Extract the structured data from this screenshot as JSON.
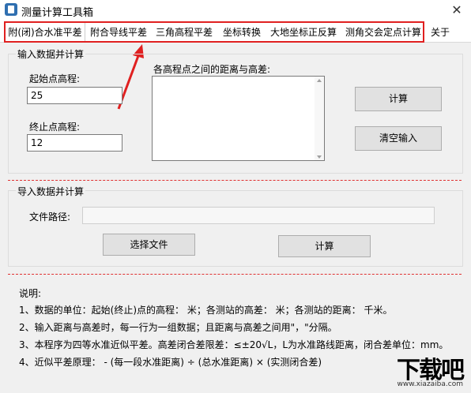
{
  "window": {
    "title": "测量计算工具箱",
    "close_glyph": "✕"
  },
  "tabs": [
    {
      "label": "附(闭)合水准平差"
    },
    {
      "label": "附合导线平差"
    },
    {
      "label": "三角高程平差"
    },
    {
      "label": "坐标转换"
    },
    {
      "label": "大地坐标正反算"
    },
    {
      "label": "测角交会定点计算"
    },
    {
      "label": "关于"
    }
  ],
  "input_group": {
    "title": "输入数据并计算",
    "start_label": "起始点高程:",
    "start_value": "25",
    "end_label": "终止点高程:",
    "end_value": "12",
    "distance_label": "各高程点之间的距离与高差:",
    "calc_button": "计算",
    "clear_button": "清空输入"
  },
  "import_group": {
    "title": "导入数据并计算",
    "path_label": "文件路径:",
    "path_value": "",
    "choose_button": "选择文件",
    "calc_button": "计算"
  },
  "notes": {
    "title": "说明:",
    "lines": [
      "1、数据的单位：起始(终止)点的高程：  米；各测站的高差：  米；各测站的距离：  千米。",
      "2、输入距离与高差时，每一行为一组数据；且距离与高差之间用\"，\"分隔。",
      "3、本程序为四等水准近似平差。高差闭合差限差：≤±20√L，L为水准路线距离，闭合差单位：mm。",
      "4、近似平差原理：  - (每一段水准距离) ÷ (总水准距离) × (实测闭合差)"
    ]
  },
  "watermark": {
    "text": "下载吧",
    "url_text": "www.xiazaiba.com"
  },
  "colors": {
    "highlight": "#e02020",
    "dashed_divider": "#e03030"
  }
}
